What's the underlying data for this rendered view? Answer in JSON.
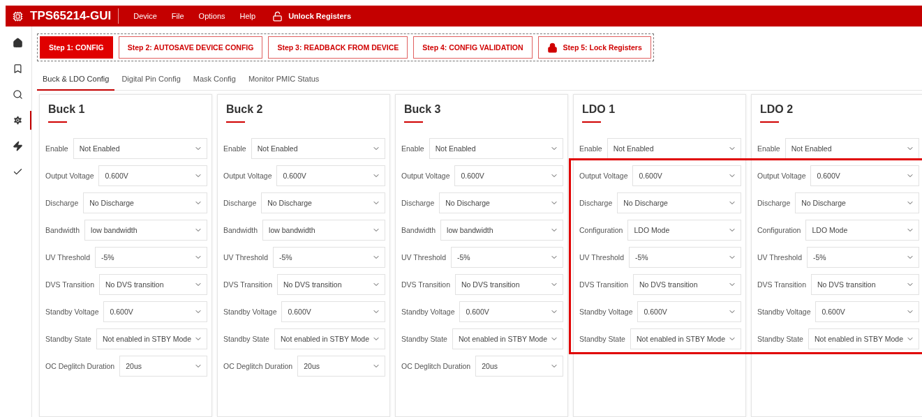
{
  "header": {
    "title": "TPS65214-GUI",
    "menu": [
      "Device",
      "File",
      "Options",
      "Help"
    ],
    "unlock": "Unlock Registers"
  },
  "sidebar": {
    "items": [
      {
        "kind": "home",
        "selected": false
      },
      {
        "kind": "bookmark",
        "selected": false
      },
      {
        "kind": "search",
        "selected": false
      },
      {
        "kind": "settings",
        "selected": true
      },
      {
        "kind": "bolt",
        "selected": false
      },
      {
        "kind": "check",
        "selected": false
      }
    ]
  },
  "steps": [
    {
      "label": "Step 1: CONFIG",
      "kind": "plain",
      "selected": true
    },
    {
      "label": "Step 2: AUTOSAVE DEVICE CONFIG",
      "kind": "plain",
      "selected": false
    },
    {
      "label": "Step 3: READBACK FROM DEVICE",
      "kind": "plain",
      "selected": false
    },
    {
      "label": "Step 4: CONFIG VALIDATION",
      "kind": "plain",
      "selected": false
    },
    {
      "label": "Step 5: Lock Registers",
      "kind": "lock",
      "selected": false
    }
  ],
  "tabs": [
    {
      "label": "Buck & LDO Config",
      "selected": true
    },
    {
      "label": "Digital Pin Config",
      "selected": false
    },
    {
      "label": "Mask Config",
      "selected": false
    },
    {
      "label": "Monitor PMIC Status",
      "selected": false
    }
  ],
  "panels": [
    {
      "title": "Buck 1",
      "fields": [
        {
          "label": "Enable",
          "value": "Not Enabled"
        },
        {
          "label": "Output Voltage",
          "value": "0.600V"
        },
        {
          "label": "Discharge",
          "value": "No Discharge"
        },
        {
          "label": "Bandwidth",
          "value": "low bandwidth"
        },
        {
          "label": "UV Threshold",
          "value": "-5%"
        },
        {
          "label": "DVS Transition",
          "value": "No DVS transition"
        },
        {
          "label": "Standby Voltage",
          "value": "0.600V"
        },
        {
          "label": "Standby State",
          "value": "Not enabled in STBY Mode"
        },
        {
          "label": "OC Deglitch Duration",
          "value": "20us"
        }
      ]
    },
    {
      "title": "Buck 2",
      "fields": [
        {
          "label": "Enable",
          "value": "Not Enabled"
        },
        {
          "label": "Output Voltage",
          "value": "0.600V"
        },
        {
          "label": "Discharge",
          "value": "No Discharge"
        },
        {
          "label": "Bandwidth",
          "value": "low bandwidth"
        },
        {
          "label": "UV Threshold",
          "value": "-5%"
        },
        {
          "label": "DVS Transition",
          "value": "No DVS transition"
        },
        {
          "label": "Standby Voltage",
          "value": "0.600V"
        },
        {
          "label": "Standby State",
          "value": "Not enabled in STBY Mode"
        },
        {
          "label": "OC Deglitch Duration",
          "value": "20us"
        }
      ]
    },
    {
      "title": "Buck 3",
      "fields": [
        {
          "label": "Enable",
          "value": "Not Enabled"
        },
        {
          "label": "Output Voltage",
          "value": "0.600V"
        },
        {
          "label": "Discharge",
          "value": "No Discharge"
        },
        {
          "label": "Bandwidth",
          "value": "low bandwidth"
        },
        {
          "label": "UV Threshold",
          "value": "-5%"
        },
        {
          "label": "DVS Transition",
          "value": "No DVS transition"
        },
        {
          "label": "Standby Voltage",
          "value": "0.600V"
        },
        {
          "label": "Standby State",
          "value": "Not enabled in STBY Mode"
        },
        {
          "label": "OC Deglitch Duration",
          "value": "20us"
        }
      ]
    },
    {
      "title": "LDO 1",
      "fields": [
        {
          "label": "Enable",
          "value": "Not Enabled"
        },
        {
          "label": "Output Voltage",
          "value": "0.600V"
        },
        {
          "label": "Discharge",
          "value": "No Discharge"
        },
        {
          "label": "Configuration",
          "value": "LDO Mode"
        },
        {
          "label": "UV Threshold",
          "value": "-5%"
        },
        {
          "label": "DVS Transition",
          "value": "No DVS transition"
        },
        {
          "label": "Standby Voltage",
          "value": "0.600V"
        },
        {
          "label": "Standby State",
          "value": "Not enabled in STBY Mode"
        }
      ]
    },
    {
      "title": "LDO 2",
      "fields": [
        {
          "label": "Enable",
          "value": "Not Enabled"
        },
        {
          "label": "Output Voltage",
          "value": "0.600V"
        },
        {
          "label": "Discharge",
          "value": "No Discharge"
        },
        {
          "label": "Configuration",
          "value": "LDO Mode"
        },
        {
          "label": "UV Threshold",
          "value": "-5%"
        },
        {
          "label": "DVS Transition",
          "value": "No DVS transition"
        },
        {
          "label": "Standby Voltage",
          "value": "0.600V"
        },
        {
          "label": "Standby State",
          "value": "Not enabled in STBY Mode"
        }
      ]
    }
  ],
  "annotation": {
    "kind": "highlight-frame"
  }
}
